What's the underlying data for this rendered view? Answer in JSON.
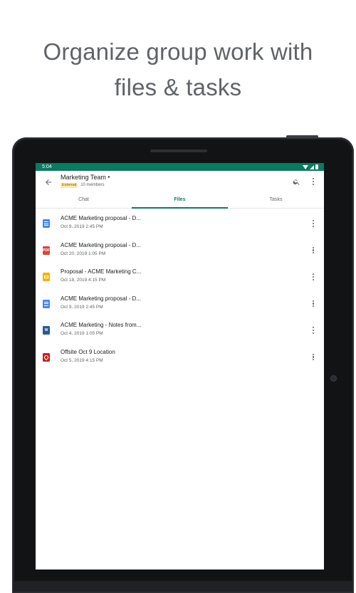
{
  "headline": {
    "line1": "Organize group work with",
    "line2": "files & tasks"
  },
  "status_bar": {
    "time": "5:04"
  },
  "app_bar": {
    "back_icon": "arrow-left-icon",
    "title": "Marketing Team",
    "title_caret": "▸",
    "badge": "External",
    "members": "10 members",
    "search_icon": "search-icon",
    "more_icon": "more-vertical-icon"
  },
  "tabs": [
    {
      "label": "Chat",
      "active": false
    },
    {
      "label": "Files",
      "active": true
    },
    {
      "label": "Tasks",
      "active": false
    }
  ],
  "colors": {
    "accent": "#0b7a5f",
    "doc": "#4285f4",
    "pdf": "#db4437",
    "slides": "#f4b400",
    "word": "#2b579a",
    "map": "#c5221f"
  },
  "files": [
    {
      "name": "ACME Marketing proposal - D...",
      "date": "Oct 9, 2019 2:45 PM",
      "icon": "google-doc-icon"
    },
    {
      "name": "ACME Marketing proposal - D...",
      "date": "Oct 20, 2019 1:05 PM",
      "icon": "pdf-icon",
      "icon_text": "PDF"
    },
    {
      "name": "Proposal - ACME Marketing C...",
      "date": "Oct 18, 2019 4:15 PM",
      "icon": "google-slides-icon"
    },
    {
      "name": "ACME Marketing proposal - D...",
      "date": "Oct 9, 2019 2:45 PM",
      "icon": "google-doc-icon"
    },
    {
      "name": "ACME Marketing -  Notes from...",
      "date": "Oct 4, 2019 1:05 PM",
      "icon": "word-icon",
      "icon_text": "W"
    },
    {
      "name": "Offsite Oct 9 Location",
      "date": "Oct 5, 2019 4:15 PM",
      "icon": "map-location-icon"
    }
  ]
}
